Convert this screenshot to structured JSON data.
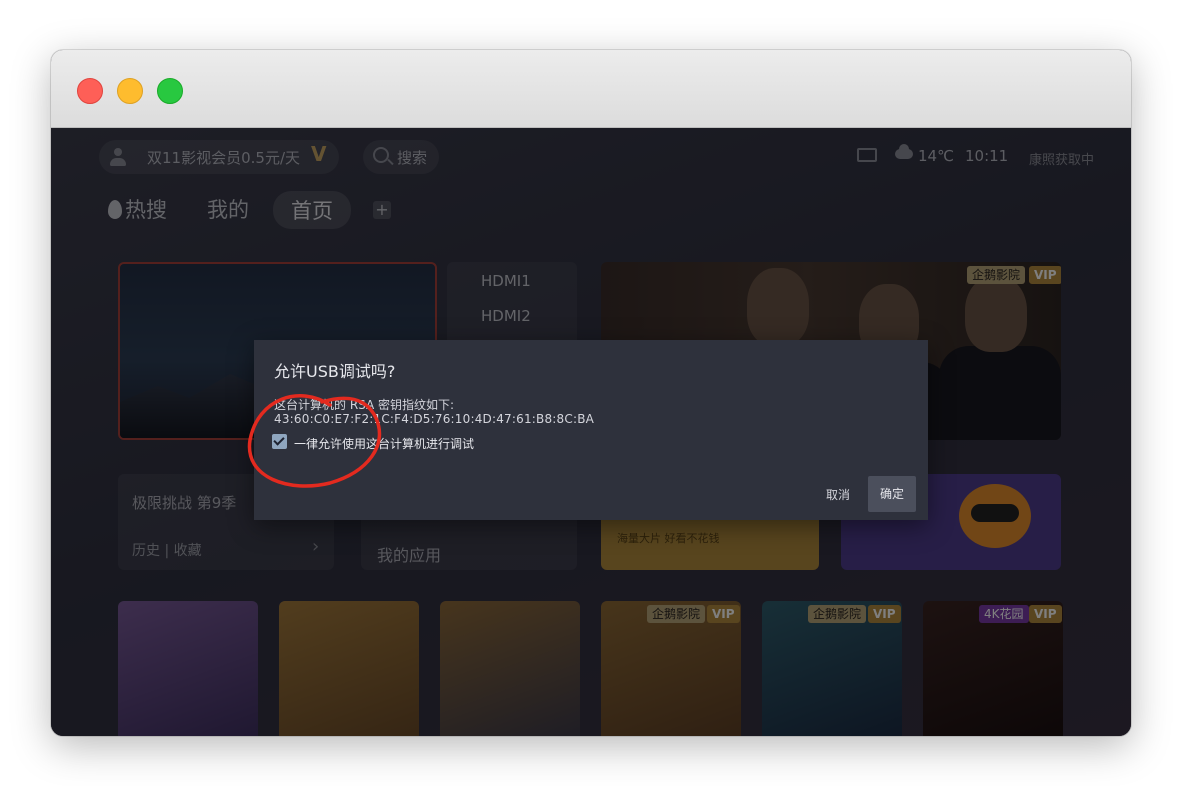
{
  "window": {
    "controls": [
      "close",
      "minimize",
      "zoom"
    ]
  },
  "topbar": {
    "promo": "双11影视会员0.5元/天",
    "vip_mark": "V",
    "search_label": "搜索",
    "temperature": "14℃",
    "time": "10:11",
    "location": "康照获取中"
  },
  "tabs": {
    "hot": "热搜",
    "mine": "我的",
    "home": "首页",
    "add": "+"
  },
  "content": {
    "hdmi1": "HDMI1",
    "hdmi2": "HDMI2",
    "history_title": "极限挑战 第9季",
    "history_links": "历史 | 收藏",
    "history_arrow": "›",
    "apps_title": "我的应用",
    "promo1_text": "海量大片 好看不花钱",
    "badge_brand": "企鹅影院",
    "badge_vip": "VIP",
    "badge_4k": "4K花园"
  },
  "dialog": {
    "title": "允许USB调试吗?",
    "message_line1": "这台计算机的 RSA 密钥指纹如下:",
    "fingerprint": "43:60:C0:E7:F2:1C:F4:D5:76:10:4D:47:61:B8:8C:BA",
    "checkbox_label": "一律允许使用这台计算机进行调试",
    "checkbox_checked": true,
    "cancel": "取消",
    "ok": "确定"
  },
  "colors": {
    "annotation_circle": "#e32a1f",
    "live_border": "#a8413a",
    "vip_gold": "#b38a3e"
  }
}
